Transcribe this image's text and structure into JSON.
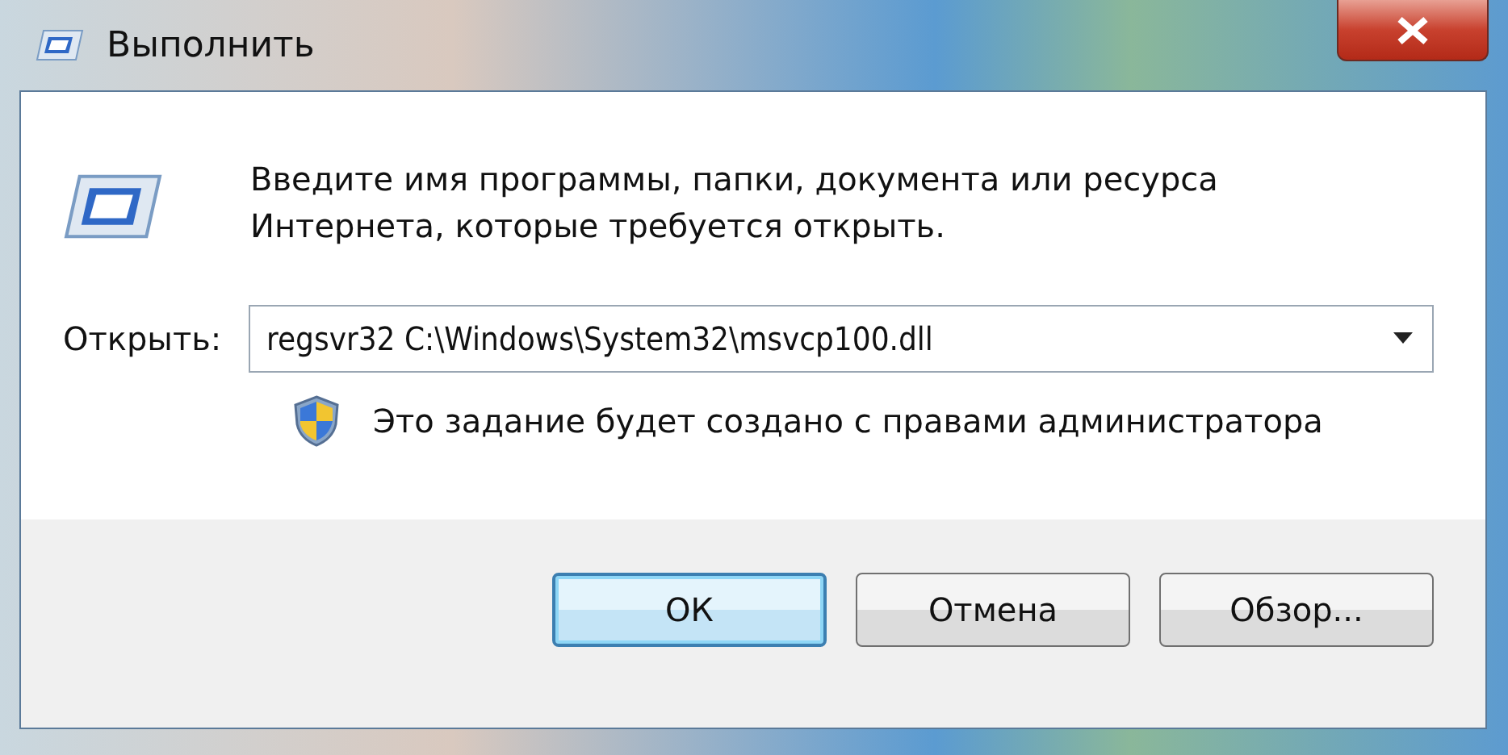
{
  "window": {
    "title": "Выполнить"
  },
  "prompt": "Введите имя программы, папки, документа или ресурса Интернета, которые требуется открыть.",
  "open_field": {
    "label": "Открыть:",
    "value": "regsvr32 C:\\Windows\\System32\\msvcp100.dll"
  },
  "admin_note": "Это задание будет создано с правами администратора",
  "buttons": [
    {
      "label": "ОК",
      "selected": true
    },
    {
      "label": "Отмена",
      "selected": false
    },
    {
      "label": "Обзор...",
      "selected": false
    }
  ]
}
